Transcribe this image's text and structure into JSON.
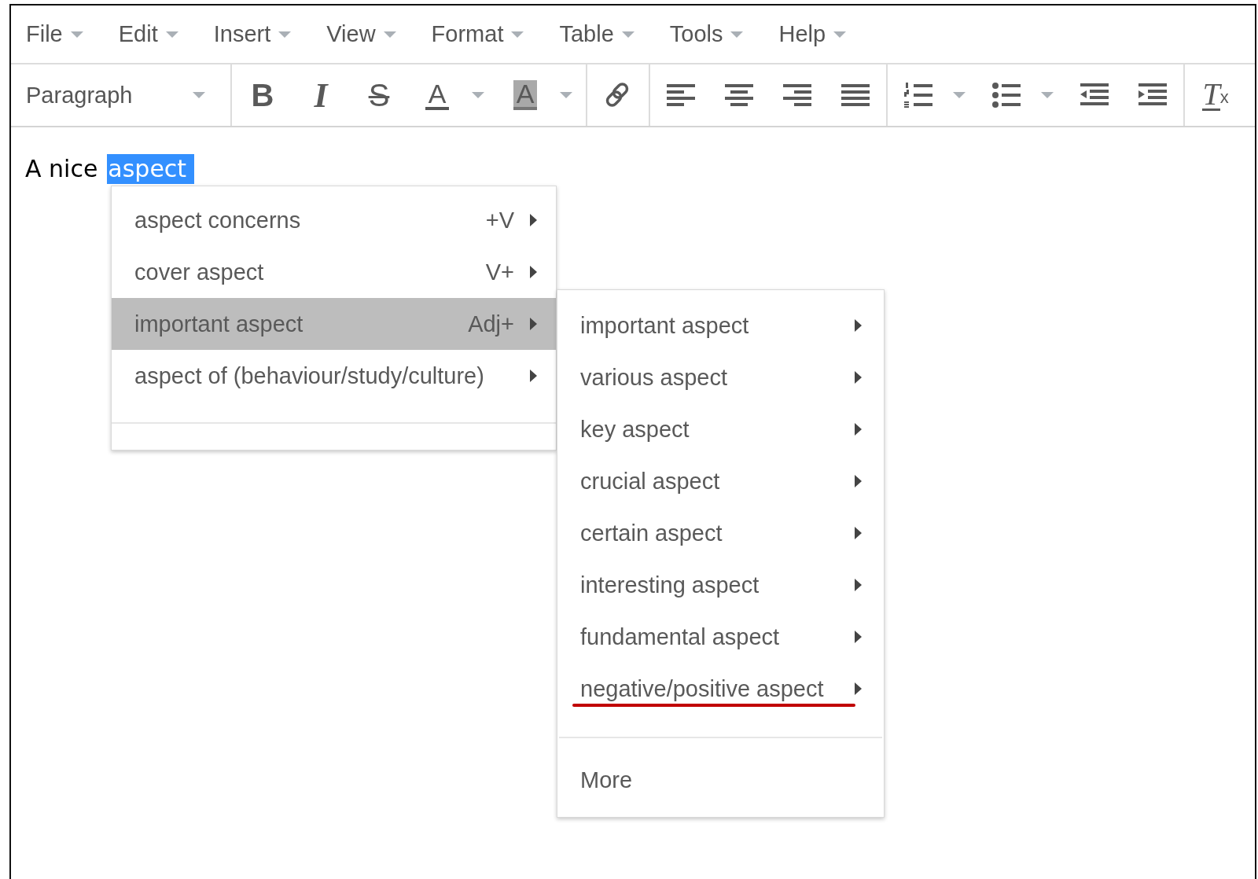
{
  "menubar": [
    {
      "label": "File"
    },
    {
      "label": "Edit"
    },
    {
      "label": "Insert"
    },
    {
      "label": "View"
    },
    {
      "label": "Format"
    },
    {
      "label": "Table"
    },
    {
      "label": "Tools"
    },
    {
      "label": "Help"
    }
  ],
  "toolbar": {
    "format_select": "Paragraph",
    "groups": [
      [
        {
          "kind": "bold",
          "glyph": "B"
        },
        {
          "kind": "italic",
          "glyph": "I"
        },
        {
          "kind": "strike",
          "glyph": "S"
        },
        {
          "kind": "forecolor",
          "glyph": "A",
          "dropdown": true
        },
        {
          "kind": "backcolor",
          "glyph": "A",
          "dropdown": true
        }
      ],
      [
        {
          "kind": "link"
        }
      ],
      [
        {
          "kind": "alignleft"
        },
        {
          "kind": "aligncenter"
        },
        {
          "kind": "alignright"
        },
        {
          "kind": "justify"
        }
      ],
      [
        {
          "kind": "numlist",
          "dropdown": true
        },
        {
          "kind": "bullist",
          "dropdown": true
        },
        {
          "kind": "outdent"
        },
        {
          "kind": "indent"
        }
      ],
      [
        {
          "kind": "clearformat",
          "glyph": "T",
          "sub": "x"
        }
      ]
    ]
  },
  "document": {
    "text": "A nice",
    "selection": "aspect"
  },
  "context_menu": {
    "items": [
      {
        "label": "aspect concerns",
        "shortcut": "+V",
        "selected": false
      },
      {
        "label": "cover aspect",
        "shortcut": "V+",
        "selected": false
      },
      {
        "label": "important aspect",
        "shortcut": "Adj+",
        "selected": true
      },
      {
        "label": "aspect of (behaviour/study/culture)",
        "selected": false
      }
    ]
  },
  "submenu": {
    "items": [
      {
        "label": "important aspect",
        "underlined": false
      },
      {
        "label": "various aspect",
        "underlined": false
      },
      {
        "label": "key aspect",
        "underlined": false
      },
      {
        "label": "crucial aspect",
        "underlined": false
      },
      {
        "label": "certain aspect",
        "underlined": false
      },
      {
        "label": "interesting aspect",
        "underlined": false
      },
      {
        "label": "fundamental aspect",
        "underlined": false
      },
      {
        "label": "negative/positive aspect",
        "underlined": true
      }
    ],
    "more": "More"
  }
}
